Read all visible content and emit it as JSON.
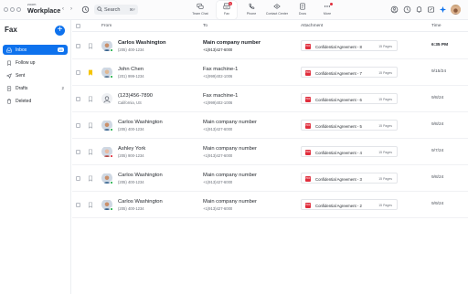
{
  "app": {
    "brand_small": "zoom",
    "brand_big": "Workplace"
  },
  "search": {
    "placeholder": "Search",
    "shortcut": "⌘F"
  },
  "tabs": [
    {
      "label": "Team Chat"
    },
    {
      "label": "Fax",
      "badge": "1",
      "active": true
    },
    {
      "label": "Phone"
    },
    {
      "label": "Contact Center"
    },
    {
      "label": "Docs"
    },
    {
      "label": "More"
    }
  ],
  "sidebar": {
    "title": "Fax",
    "items": [
      {
        "label": "Inbox",
        "count": "15",
        "active": true
      },
      {
        "label": "Follow up",
        "count": ""
      },
      {
        "label": "Sent",
        "count": ""
      },
      {
        "label": "Drafts",
        "count": "2"
      },
      {
        "label": "Deleted",
        "count": ""
      }
    ]
  },
  "table": {
    "headers": {
      "from": "From",
      "to": "To",
      "attachment": "Attachment",
      "time": "Time"
    },
    "rows": [
      {
        "from_name": "Carlos Washington",
        "from_sub": "(205) 400-1234",
        "to_name": "Main company number",
        "to_sub": "+1(913)427-6000",
        "attachment": "Confidential Agreement - 8",
        "pages": "15 Pages",
        "time": "6:35 PM",
        "unread": true,
        "flagged": false,
        "status": "#22b04b"
      },
      {
        "from_name": "John Chen",
        "from_sub": "(201) 999-1234",
        "to_name": "Fax machine-1",
        "to_sub": "+1(999)402-1006",
        "attachment": "Confidential Agreement - 7",
        "pages": "15 Pages",
        "time": "9/15/24",
        "unread": false,
        "flagged": true,
        "status": "#22b04b"
      },
      {
        "from_name": "(123)456-7890",
        "from_sub": "California, US",
        "to_name": "Fax machine-1",
        "to_sub": "+1(999)402-1006",
        "attachment": "Confidential Agreement - 6",
        "pages": "15 Pages",
        "time": "9/8/24",
        "unread": false,
        "flagged": false,
        "status": ""
      },
      {
        "from_name": "Carlos Washington",
        "from_sub": "(205) 400-1234",
        "to_name": "Main company number",
        "to_sub": "+1(913)427-6000",
        "attachment": "Confidential Agreement - 5",
        "pages": "15 Pages",
        "time": "9/8/24",
        "unread": false,
        "flagged": false,
        "status": "#22b04b"
      },
      {
        "from_name": "Ashley York",
        "from_sub": "(205) 900-1234",
        "to_name": "Main company number",
        "to_sub": "+1(913)427-6000",
        "attachment": "Confidential Agreement - 4",
        "pages": "15 Pages",
        "time": "9/7/24",
        "unread": false,
        "flagged": false,
        "status": "#e02d3c"
      },
      {
        "from_name": "Carlos Washington",
        "from_sub": "(205) 400-1234",
        "to_name": "Main company number",
        "to_sub": "+1(913)427-6000",
        "attachment": "Confidential Agreement - 3",
        "pages": "15 Pages",
        "time": "9/8/24",
        "unread": false,
        "flagged": false,
        "status": "#22b04b"
      },
      {
        "from_name": "Carlos Washington",
        "from_sub": "(205) 400-1234",
        "to_name": "Main company number",
        "to_sub": "+1(913)427-6000",
        "attachment": "Confidential Agreement - 2",
        "pages": "15 Pages",
        "time": "9/9/24",
        "unread": false,
        "flagged": false,
        "status": "#22b04b"
      }
    ]
  },
  "colors": {
    "accent": "#0e72ed",
    "flag": "#f5c400",
    "pdf": "#e02d3c",
    "online": "#22b04b",
    "busy": "#e02d3c"
  }
}
